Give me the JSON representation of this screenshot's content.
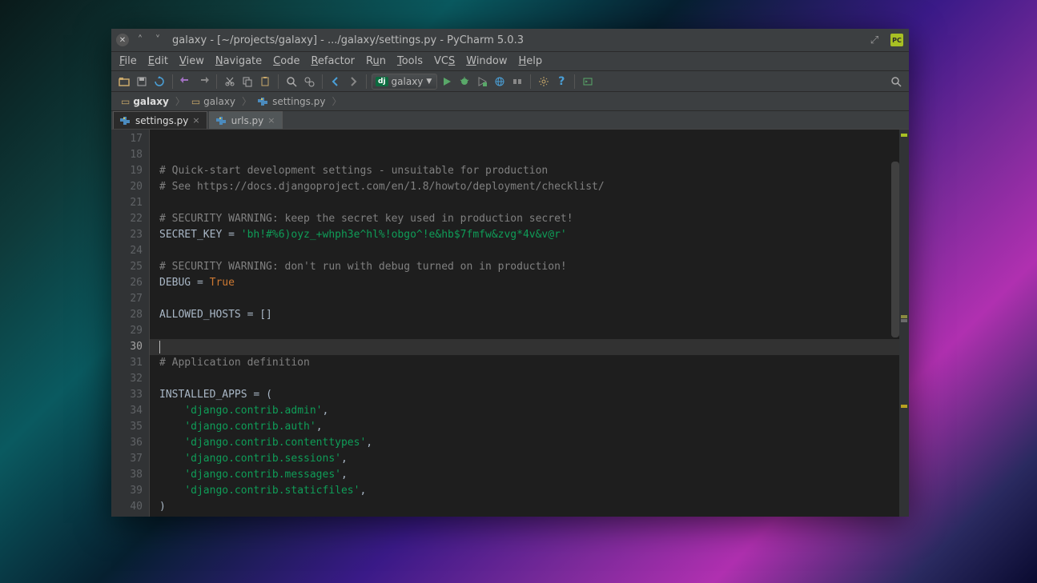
{
  "window": {
    "title": "galaxy - [~/projects/galaxy] - .../galaxy/settings.py - PyCharm 5.0.3"
  },
  "menu": [
    "File",
    "Edit",
    "View",
    "Navigate",
    "Code",
    "Refactor",
    "Run",
    "Tools",
    "VCS",
    "Window",
    "Help"
  ],
  "run_config": {
    "label": "galaxy"
  },
  "breadcrumbs": [
    {
      "label": "galaxy",
      "type": "folder-bold"
    },
    {
      "label": "galaxy",
      "type": "folder"
    },
    {
      "label": "settings.py",
      "type": "py"
    }
  ],
  "tabs": [
    {
      "label": "settings.py",
      "active": true
    },
    {
      "label": "urls.py",
      "active": false
    }
  ],
  "editor": {
    "first_line": 17,
    "current_line": 30,
    "lines": [
      {
        "n": 17,
        "t": [
          {
            "c": "",
            "s": ""
          }
        ]
      },
      {
        "n": 18,
        "t": [
          {
            "c": "",
            "s": ""
          }
        ]
      },
      {
        "n": 19,
        "t": [
          {
            "c": "# Quick-start development settings - unsuitable for production",
            "s": "cmt"
          }
        ]
      },
      {
        "n": 20,
        "t": [
          {
            "c": "# See https://docs.djangoproject.com/en/1.8/howto/deployment/checklist/",
            "s": "cmt"
          }
        ]
      },
      {
        "n": 21,
        "t": [
          {
            "c": "",
            "s": ""
          }
        ]
      },
      {
        "n": 22,
        "t": [
          {
            "c": "# SECURITY WARNING: keep the secret key used in production secret!",
            "s": "cmt"
          }
        ]
      },
      {
        "n": 23,
        "t": [
          {
            "c": "SECRET_KEY ",
            "s": "op"
          },
          {
            "c": "=",
            "s": "op"
          },
          {
            "c": " ",
            "s": ""
          },
          {
            "c": "'bh!#%6)oyz_+whph3e^hl%!obgo^!e&hb$7fmfw&zvg*4v&v@r'",
            "s": "str"
          }
        ]
      },
      {
        "n": 24,
        "t": [
          {
            "c": "",
            "s": ""
          }
        ]
      },
      {
        "n": 25,
        "t": [
          {
            "c": "# SECURITY WARNING: don't run with debug turned on in production!",
            "s": "cmt"
          }
        ]
      },
      {
        "n": 26,
        "t": [
          {
            "c": "DEBUG ",
            "s": "op"
          },
          {
            "c": "=",
            "s": "op"
          },
          {
            "c": " ",
            "s": ""
          },
          {
            "c": "True",
            "s": "kw"
          }
        ]
      },
      {
        "n": 27,
        "t": [
          {
            "c": "",
            "s": ""
          }
        ]
      },
      {
        "n": 28,
        "t": [
          {
            "c": "ALLOWED_HOSTS ",
            "s": "op"
          },
          {
            "c": "=",
            "s": "op"
          },
          {
            "c": " ",
            "s": ""
          },
          {
            "c": "[]",
            "s": "br"
          }
        ]
      },
      {
        "n": 29,
        "t": [
          {
            "c": "",
            "s": ""
          }
        ]
      },
      {
        "n": 30,
        "t": [
          {
            "c": "",
            "s": ""
          }
        ]
      },
      {
        "n": 31,
        "t": [
          {
            "c": "# Application definition",
            "s": "cmt"
          }
        ]
      },
      {
        "n": 32,
        "t": [
          {
            "c": "",
            "s": ""
          }
        ]
      },
      {
        "n": 33,
        "t": [
          {
            "c": "INSTALLED_APPS ",
            "s": "op"
          },
          {
            "c": "=",
            "s": "op"
          },
          {
            "c": " ",
            "s": ""
          },
          {
            "c": "(",
            "s": "br"
          }
        ]
      },
      {
        "n": 34,
        "t": [
          {
            "c": "    ",
            "s": ""
          },
          {
            "c": "'django.contrib.admin'",
            "s": "str"
          },
          {
            "c": ",",
            "s": "op"
          }
        ]
      },
      {
        "n": 35,
        "t": [
          {
            "c": "    ",
            "s": ""
          },
          {
            "c": "'django.contrib.auth'",
            "s": "str"
          },
          {
            "c": ",",
            "s": "op"
          }
        ]
      },
      {
        "n": 36,
        "t": [
          {
            "c": "    ",
            "s": ""
          },
          {
            "c": "'django.contrib.contenttypes'",
            "s": "str"
          },
          {
            "c": ",",
            "s": "op"
          }
        ]
      },
      {
        "n": 37,
        "t": [
          {
            "c": "    ",
            "s": ""
          },
          {
            "c": "'django.contrib.sessions'",
            "s": "str"
          },
          {
            "c": ",",
            "s": "op"
          }
        ]
      },
      {
        "n": 38,
        "t": [
          {
            "c": "    ",
            "s": ""
          },
          {
            "c": "'django.contrib.messages'",
            "s": "str"
          },
          {
            "c": ",",
            "s": "op"
          }
        ]
      },
      {
        "n": 39,
        "t": [
          {
            "c": "    ",
            "s": ""
          },
          {
            "c": "'django.contrib.staticfiles'",
            "s": "str"
          },
          {
            "c": ",",
            "s": "op"
          }
        ]
      },
      {
        "n": 40,
        "t": [
          {
            "c": ")",
            "s": "br"
          }
        ]
      }
    ]
  },
  "markers": [
    {
      "top": "1%",
      "color": "#a8c023"
    },
    {
      "top": "48%",
      "color": "#8a8a40"
    },
    {
      "top": "49%",
      "color": "#6a6a6a"
    },
    {
      "top": "71%",
      "color": "#b8a020"
    }
  ]
}
